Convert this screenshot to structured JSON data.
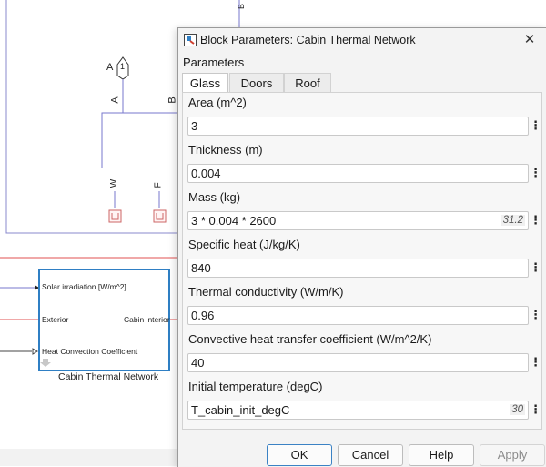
{
  "canvas": {
    "inport_a": {
      "label": "A",
      "number": "1"
    },
    "port_labels": {
      "a": "A",
      "b": "B",
      "w": "W",
      "f": "F",
      "top_b": "B"
    },
    "block": {
      "title": "Cabin Thermal Network",
      "ports": {
        "solar": "Solar irradiation [W/m^2]",
        "exterior": "Exterior",
        "cabin": "Cabin interior",
        "heat": "Heat Convection Coefficient"
      }
    }
  },
  "dialog": {
    "title": "Block Parameters: Cabin Thermal Network",
    "close_glyph": "✕",
    "section_header": "Parameters",
    "tabs": [
      {
        "label": "Glass",
        "active": true
      },
      {
        "label": "Doors",
        "active": false
      },
      {
        "label": "Roof",
        "active": false
      }
    ],
    "params": [
      {
        "label": "Area (m^2)",
        "value": "3",
        "evaluated": ""
      },
      {
        "label": "Thickness (m)",
        "value": "0.004",
        "evaluated": ""
      },
      {
        "label": "Mass (kg)",
        "value": "3 * 0.004 * 2600",
        "evaluated": "31.2"
      },
      {
        "label": "Specific heat (J/kg/K)",
        "value": "840",
        "evaluated": ""
      },
      {
        "label": "Thermal conductivity (W/m/K)",
        "value": "0.96",
        "evaluated": ""
      },
      {
        "label": "Convective heat transfer coefficient (W/m^2/K)",
        "value": "40",
        "evaluated": ""
      },
      {
        "label": "Initial temperature (degC)",
        "value": "T_cabin_init_degC",
        "evaluated": "30"
      }
    ],
    "param_menu_glyph": "⋮",
    "buttons": {
      "ok": "OK",
      "cancel": "Cancel",
      "help": "Help",
      "apply": "Apply"
    },
    "colors": {
      "accent": "#3b82c4",
      "signal_line": "#7777cc",
      "thermal_line": "#e05050",
      "block_border": "#2f7fc4"
    }
  }
}
